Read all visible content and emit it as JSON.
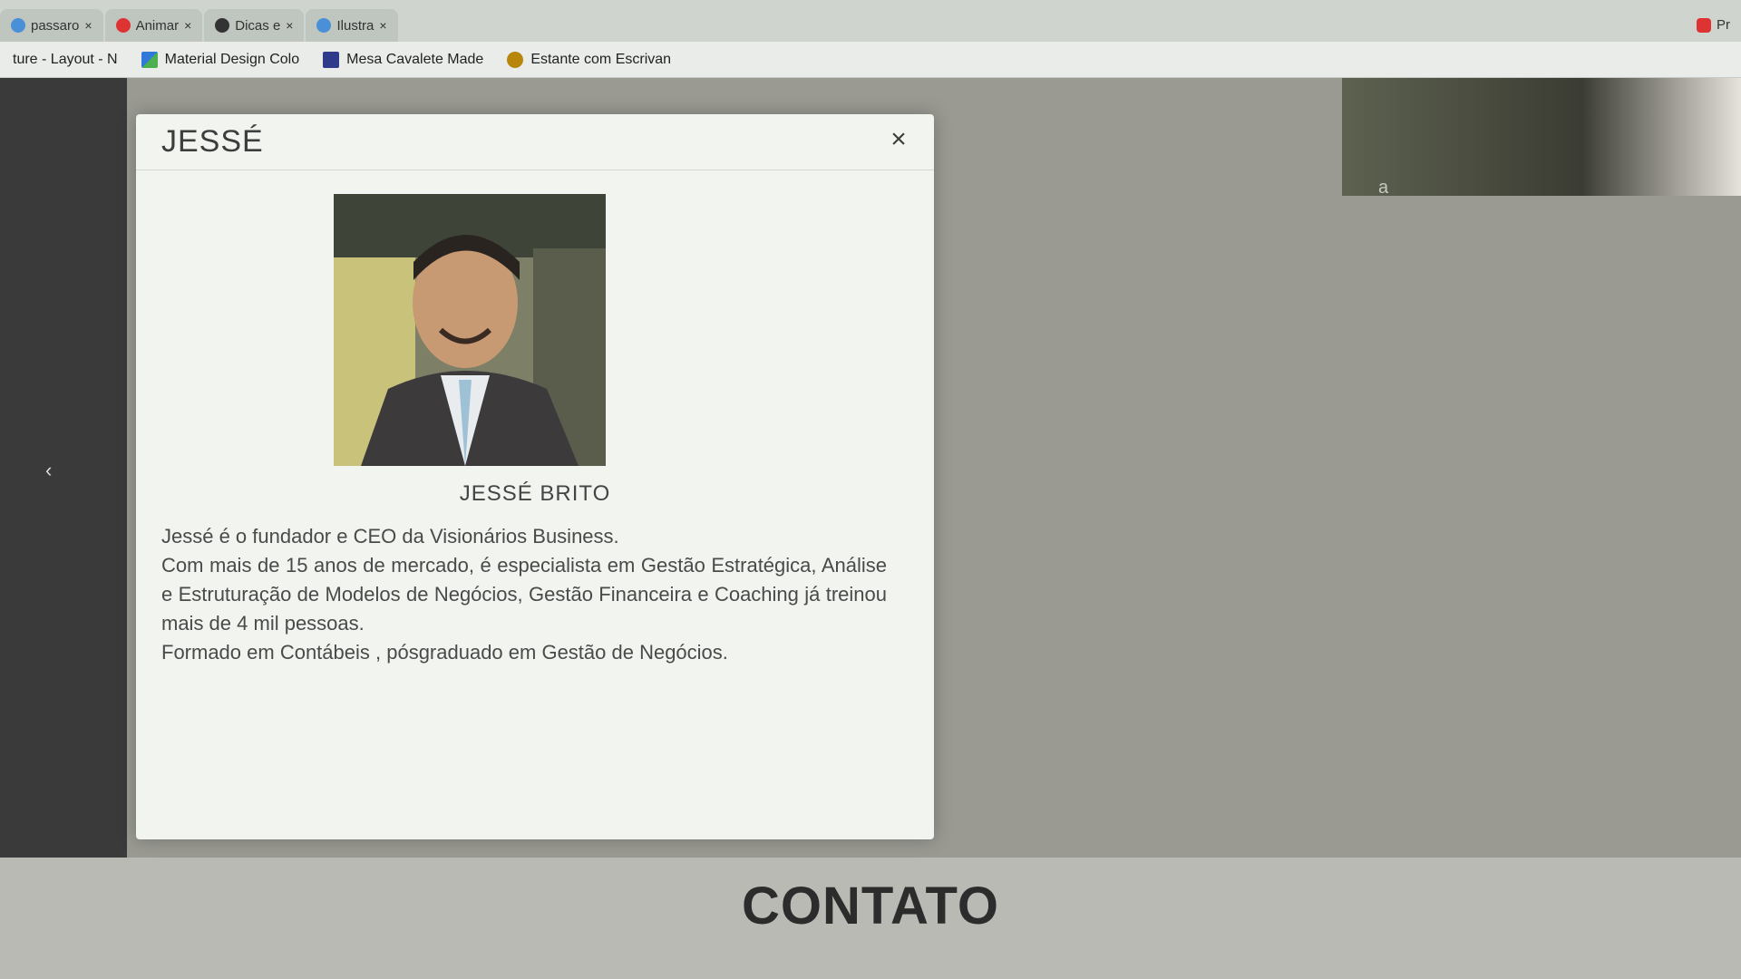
{
  "browser": {
    "tabs": [
      {
        "label": "passaro",
        "fav_color": "#4a90d9"
      },
      {
        "label": "Animar",
        "fav_color": "#d33"
      },
      {
        "label": "Dicas e",
        "fav_color": "#333"
      },
      {
        "label": "Ilustra",
        "fav_color": "#4a90d9"
      }
    ],
    "tab_close": "×",
    "tab_overflow": "Pr",
    "bookmarks": [
      {
        "label": "ture - Layout - N",
        "color": "#2f7ad8"
      },
      {
        "label": "Material Design Colo",
        "color": "#2f7ad8"
      },
      {
        "label": "Mesa Cavalete Made",
        "color": "#d33"
      },
      {
        "label": "Estante com Escrivan",
        "color": "#b8860b"
      }
    ]
  },
  "background": {
    "side_text": "a",
    "contact_heading": "CONTATO"
  },
  "modal": {
    "title": "JESSÉ",
    "close_label": "×",
    "member_name": "JESSÉ BRITO",
    "bio": [
      "Jessé é o fundador e CEO da Visionários Business.",
      "Com mais de 15 anos de mercado, é especialista em Gestão Estratégica, Análise e Estruturação de Modelos de Negócios, Gestão Financeira e Coaching já treinou mais de 4 mil pessoas.",
      "Formado em Contábeis , pósgraduado em Gestão de Negócios."
    ]
  }
}
